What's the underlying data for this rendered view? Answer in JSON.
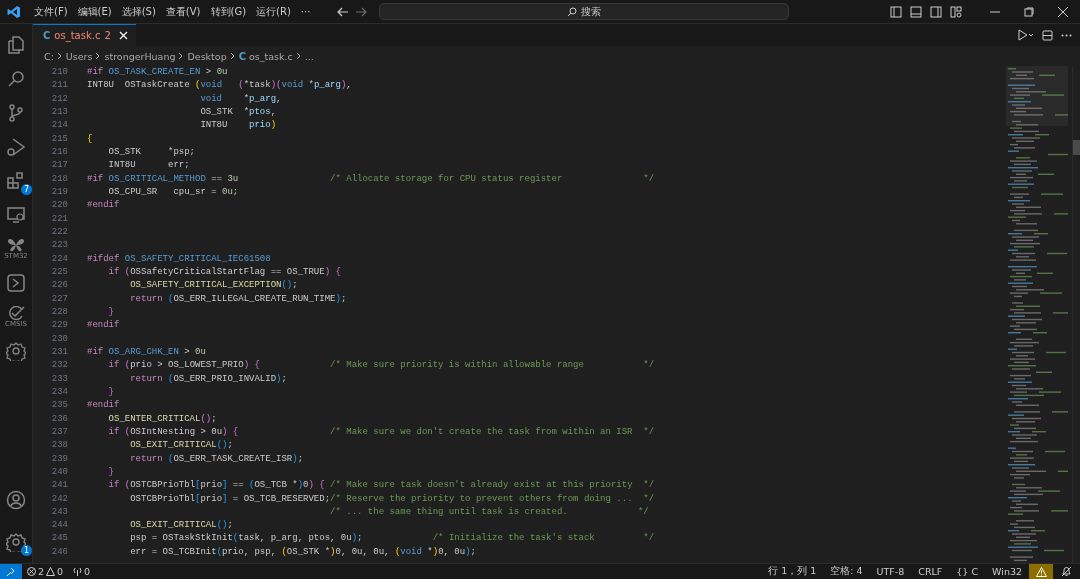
{
  "menu": [
    "文件(F)",
    "编辑(E)",
    "选择(S)",
    "查看(V)",
    "转到(G)",
    "运行(R)",
    "···"
  ],
  "search": {
    "placeholder": "搜索"
  },
  "activity": [
    {
      "kind": "files",
      "selected": false
    },
    {
      "kind": "search",
      "selected": false
    },
    {
      "kind": "branch",
      "selected": false
    },
    {
      "kind": "debug",
      "selected": false
    },
    {
      "kind": "extensions",
      "selected": false,
      "badge": "7"
    },
    {
      "kind": "remote",
      "selected": false
    },
    {
      "kind": "butterfly",
      "selected": false,
      "label": "STM32"
    },
    {
      "kind": "terminal",
      "selected": false
    },
    {
      "kind": "check",
      "selected": false,
      "label": "CMSIS"
    },
    {
      "kind": "chipgear",
      "selected": false
    }
  ],
  "activity_bottom": [
    {
      "kind": "account"
    },
    {
      "kind": "manage",
      "badge": "1"
    }
  ],
  "tabs": [
    {
      "icon": "C",
      "label": "os_task.c",
      "problems": "2",
      "selected": true
    }
  ],
  "breadcrumb": [
    {
      "text": "C:"
    },
    {
      "text": "Users"
    },
    {
      "text": "strongerHuang"
    },
    {
      "text": "Desktop"
    },
    {
      "text": "os_task.c",
      "icon": "C"
    },
    {
      "text": "..."
    }
  ],
  "code": [
    {
      "no": "210",
      "tokens": [
        {
          "kind": "pp",
          "t": "#if"
        },
        {
          "kind": "macro",
          "t": " OS_TASK_CREATE_EN"
        },
        {
          "kind": "id",
          "t": " >"
        },
        {
          "kind": "num",
          "t": " 0u"
        }
      ]
    },
    {
      "no": "211",
      "tokens": [
        {
          "kind": "id",
          "t": "INT8U  OSTaskCreate"
        },
        {
          "kind": "b1",
          "t": " ("
        },
        {
          "kind": "kw",
          "t": "void"
        },
        {
          "kind": "b2",
          "t": "   ("
        },
        {
          "kind": "id",
          "t": "*task"
        },
        {
          "kind": "b2",
          "t": ")("
        },
        {
          "kind": "kw",
          "t": "void"
        },
        {
          "kind": "id",
          "t": " *"
        },
        {
          "kind": "var",
          "t": "p_arg"
        },
        {
          "kind": "b2",
          "t": ")"
        },
        {
          "kind": "id",
          "t": ","
        }
      ]
    },
    {
      "no": "212",
      "tokens": [
        {
          "kind": "kw",
          "t": "                     void"
        },
        {
          "kind": "id",
          "t": "    *"
        },
        {
          "kind": "var",
          "t": "p_arg"
        },
        {
          "kind": "id",
          "t": ","
        }
      ]
    },
    {
      "no": "213",
      "tokens": [
        {
          "kind": "id",
          "t": "                     OS_STK  *"
        },
        {
          "kind": "var",
          "t": "ptos"
        },
        {
          "kind": "id",
          "t": ","
        }
      ]
    },
    {
      "no": "214",
      "tokens": [
        {
          "kind": "id",
          "t": "                     INT8U"
        },
        {
          "kind": "var",
          "t": "    prio"
        },
        {
          "kind": "b1",
          "t": ")"
        }
      ]
    },
    {
      "no": "215",
      "tokens": [
        {
          "kind": "b1",
          "t": "{"
        }
      ]
    },
    {
      "no": "216",
      "tokens": [
        {
          "kind": "id",
          "t": "    OS_STK     *psp;"
        }
      ]
    },
    {
      "no": "217",
      "tokens": [
        {
          "kind": "id",
          "t": "    INT8U      err;"
        }
      ]
    },
    {
      "no": "218",
      "tokens": [
        {
          "kind": "pp",
          "t": "#if"
        },
        {
          "kind": "macro",
          "t": " OS_CRITICAL_METHOD"
        },
        {
          "kind": "id",
          "t": " =="
        },
        {
          "kind": "num",
          "t": " 3u"
        },
        {
          "kind": "cm",
          "t": "                 /* Allocate storage for CPU status register               */"
        }
      ]
    },
    {
      "no": "219",
      "tokens": [
        {
          "kind": "id",
          "t": "    OS_CPU_SR   cpu_sr ="
        },
        {
          "kind": "num",
          "t": " 0u"
        },
        {
          "kind": "id",
          "t": ";"
        }
      ]
    },
    {
      "no": "220",
      "tokens": [
        {
          "kind": "pp",
          "t": "#endif"
        }
      ]
    },
    {
      "no": "221"
    },
    {
      "no": "222"
    },
    {
      "no": "223"
    },
    {
      "no": "224",
      "tokens": [
        {
          "kind": "pp",
          "t": "#ifdef"
        },
        {
          "kind": "macro",
          "t": " OS_SAFETY_CRITICAL_IEC61508"
        }
      ]
    },
    {
      "no": "225",
      "tokens": [
        {
          "kind": "ctl",
          "t": "    if"
        },
        {
          "kind": "b2",
          "t": " ("
        },
        {
          "kind": "id",
          "t": "OSSafetyCriticalStartFlag == OS_TRUE"
        },
        {
          "kind": "b2",
          "t": ") {"
        }
      ]
    },
    {
      "no": "226",
      "tokens": [
        {
          "kind": "fn",
          "t": "        OS_SAFETY_CRITICAL_EXCEPTION"
        },
        {
          "kind": "b3",
          "t": "()"
        },
        {
          "kind": "id",
          "t": ";"
        }
      ]
    },
    {
      "no": "227",
      "tokens": [
        {
          "kind": "ctl",
          "t": "        return"
        },
        {
          "kind": "b3",
          "t": " ("
        },
        {
          "kind": "id",
          "t": "OS_ERR_ILLEGAL_CREATE_RUN_TIME"
        },
        {
          "kind": "b3",
          "t": ")"
        },
        {
          "kind": "id",
          "t": ";"
        }
      ]
    },
    {
      "no": "228",
      "tokens": [
        {
          "kind": "b2",
          "t": "    }"
        }
      ]
    },
    {
      "no": "229",
      "tokens": [
        {
          "kind": "pp",
          "t": "#endif"
        }
      ]
    },
    {
      "no": "230"
    },
    {
      "no": "231",
      "tokens": [
        {
          "kind": "pp",
          "t": "#if"
        },
        {
          "kind": "macro",
          "t": " OS_ARG_CHK_EN"
        },
        {
          "kind": "id",
          "t": " >"
        },
        {
          "kind": "num",
          "t": " 0u"
        }
      ]
    },
    {
      "no": "232",
      "tokens": [
        {
          "kind": "ctl",
          "t": "    if"
        },
        {
          "kind": "b2",
          "t": " ("
        },
        {
          "kind": "id",
          "t": "prio > OS_LOWEST_PRIO"
        },
        {
          "kind": "b2",
          "t": ") {"
        },
        {
          "kind": "cm",
          "t": "             /* Make sure priority is within allowable range           */"
        }
      ]
    },
    {
      "no": "233",
      "tokens": [
        {
          "kind": "ctl",
          "t": "        return"
        },
        {
          "kind": "b3",
          "t": " ("
        },
        {
          "kind": "id",
          "t": "OS_ERR_PRIO_INVALID"
        },
        {
          "kind": "b3",
          "t": ")"
        },
        {
          "kind": "id",
          "t": ";"
        }
      ]
    },
    {
      "no": "234",
      "tokens": [
        {
          "kind": "b2",
          "t": "    }"
        }
      ]
    },
    {
      "no": "235",
      "tokens": [
        {
          "kind": "pp",
          "t": "#endif"
        }
      ]
    },
    {
      "no": "236",
      "tokens": [
        {
          "kind": "fn",
          "t": "    OS_ENTER_CRITICAL"
        },
        {
          "kind": "b2",
          "t": "()"
        },
        {
          "kind": "id",
          "t": ";"
        }
      ]
    },
    {
      "no": "237",
      "tokens": [
        {
          "kind": "ctl",
          "t": "    if"
        },
        {
          "kind": "b2",
          "t": " ("
        },
        {
          "kind": "id",
          "t": "OSIntNesting > 0u"
        },
        {
          "kind": "b2",
          "t": ") {"
        },
        {
          "kind": "cm",
          "t": "                 /* Make sure we don't create the task from within an ISR  */"
        }
      ]
    },
    {
      "no": "238",
      "tokens": [
        {
          "kind": "fn",
          "t": "        OS_EXIT_CRITICAL"
        },
        {
          "kind": "b3",
          "t": "()"
        },
        {
          "kind": "id",
          "t": ";"
        }
      ]
    },
    {
      "no": "239",
      "tokens": [
        {
          "kind": "ctl",
          "t": "        return"
        },
        {
          "kind": "b3",
          "t": " ("
        },
        {
          "kind": "id",
          "t": "OS_ERR_TASK_CREATE_ISR"
        },
        {
          "kind": "b3",
          "t": ")"
        },
        {
          "kind": "id",
          "t": ";"
        }
      ]
    },
    {
      "no": "240",
      "tokens": [
        {
          "kind": "b2",
          "t": "    }"
        }
      ]
    },
    {
      "no": "241",
      "tokens": [
        {
          "kind": "ctl",
          "t": "    if"
        },
        {
          "kind": "b2",
          "t": " ("
        },
        {
          "kind": "id",
          "t": "OSTCBPrioTbl"
        },
        {
          "kind": "b3",
          "t": "["
        },
        {
          "kind": "id",
          "t": "prio"
        },
        {
          "kind": "b3",
          "t": "]"
        },
        {
          "kind": "id",
          "t": " =="
        },
        {
          "kind": "b3",
          "t": " ("
        },
        {
          "kind": "id",
          "t": "OS_TCB *"
        },
        {
          "kind": "b3",
          "t": ")"
        },
        {
          "kind": "id",
          "t": "0"
        },
        {
          "kind": "b2",
          "t": ") {"
        },
        {
          "kind": "cm",
          "t": " /* Make sure task doesn't already exist at this priority  */"
        }
      ]
    },
    {
      "no": "242",
      "tokens": [
        {
          "kind": "id",
          "t": "        OSTCBPrioTbl"
        },
        {
          "kind": "b3",
          "t": "["
        },
        {
          "kind": "id",
          "t": "prio"
        },
        {
          "kind": "b3",
          "t": "]"
        },
        {
          "kind": "id",
          "t": " = OS_TCB_RESERVED;"
        },
        {
          "kind": "cm",
          "t": "/* Reserve the priority to prevent others from doing ...  */"
        }
      ]
    },
    {
      "no": "243",
      "tokens": [
        {
          "kind": "cm",
          "t": "                                             /* ... the same thing until task is created.             */"
        }
      ]
    },
    {
      "no": "244",
      "tokens": [
        {
          "kind": "fn",
          "t": "        OS_EXIT_CRITICAL"
        },
        {
          "kind": "b3",
          "t": "()"
        },
        {
          "kind": "id",
          "t": ";"
        }
      ]
    },
    {
      "no": "245",
      "tokens": [
        {
          "kind": "id",
          "t": "        psp = OSTaskStkInit"
        },
        {
          "kind": "b3",
          "t": "("
        },
        {
          "kind": "id",
          "t": "task, p_arg, ptos, 0u"
        },
        {
          "kind": "b3",
          "t": ")"
        },
        {
          "kind": "id",
          "t": ";"
        },
        {
          "kind": "cm",
          "t": "             /* Initialize the task's stack         */"
        }
      ]
    },
    {
      "no": "246",
      "tokens": [
        {
          "kind": "id",
          "t": "        err = OS_TCBInit"
        },
        {
          "kind": "b3",
          "t": "("
        },
        {
          "kind": "id",
          "t": "prio, psp, "
        },
        {
          "kind": "b1",
          "t": "("
        },
        {
          "kind": "id",
          "t": "OS_STK *"
        },
        {
          "kind": "b1",
          "t": ")"
        },
        {
          "kind": "id",
          "t": "0, 0u, 0u, "
        },
        {
          "kind": "b1",
          "t": "("
        },
        {
          "kind": "kw",
          "t": "void"
        },
        {
          "kind": "id",
          "t": " *"
        },
        {
          "kind": "b1",
          "t": ")"
        },
        {
          "kind": "id",
          "t": "0, 0u"
        },
        {
          "kind": "b3",
          "t": ")"
        },
        {
          "kind": "id",
          "t": ";"
        }
      ]
    }
  ],
  "status_left": {
    "errors": "2",
    "warnings": "0",
    "ports": "0"
  },
  "status_right": [
    "行 1，列 1",
    "空格: 4",
    "UTF-8",
    "CRLF",
    "{} C",
    "Win32"
  ]
}
